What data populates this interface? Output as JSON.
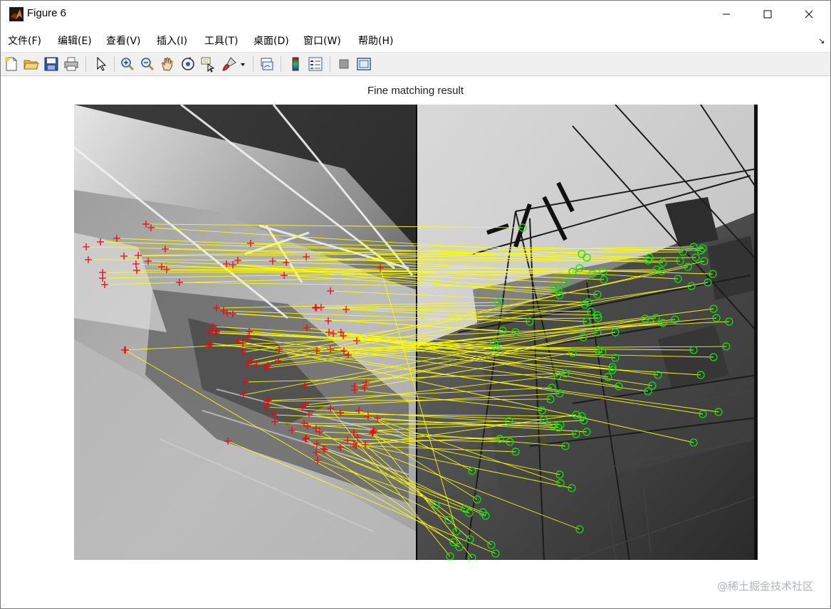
{
  "window": {
    "title": "Figure 6"
  },
  "menu": {
    "items": [
      "文件(F)",
      "编辑(E)",
      "查看(V)",
      "插入(I)",
      "工具(T)",
      "桌面(D)",
      "窗口(W)",
      "帮助(H)"
    ]
  },
  "toolbar": {
    "icons": [
      "new-figure-icon",
      "open-file-icon",
      "save-icon",
      "print-icon",
      "select-arrow-icon",
      "zoom-in-icon",
      "zoom-out-icon",
      "pan-hand-icon",
      "rotate-3d-icon",
      "data-cursor-icon",
      "brush-icon",
      "brush-dropdown-icon",
      "link-plot-icon",
      "insert-colorbar-icon",
      "insert-legend-icon",
      "hide-plot-tools-icon",
      "show-plot-tools-icon"
    ]
  },
  "figure": {
    "title": "Fine matching result",
    "marker_colors": {
      "left": "#ff0000",
      "right": "#00ee00",
      "line": "#ffff00"
    }
  },
  "watermark": "@稀土掘金技术社区"
}
